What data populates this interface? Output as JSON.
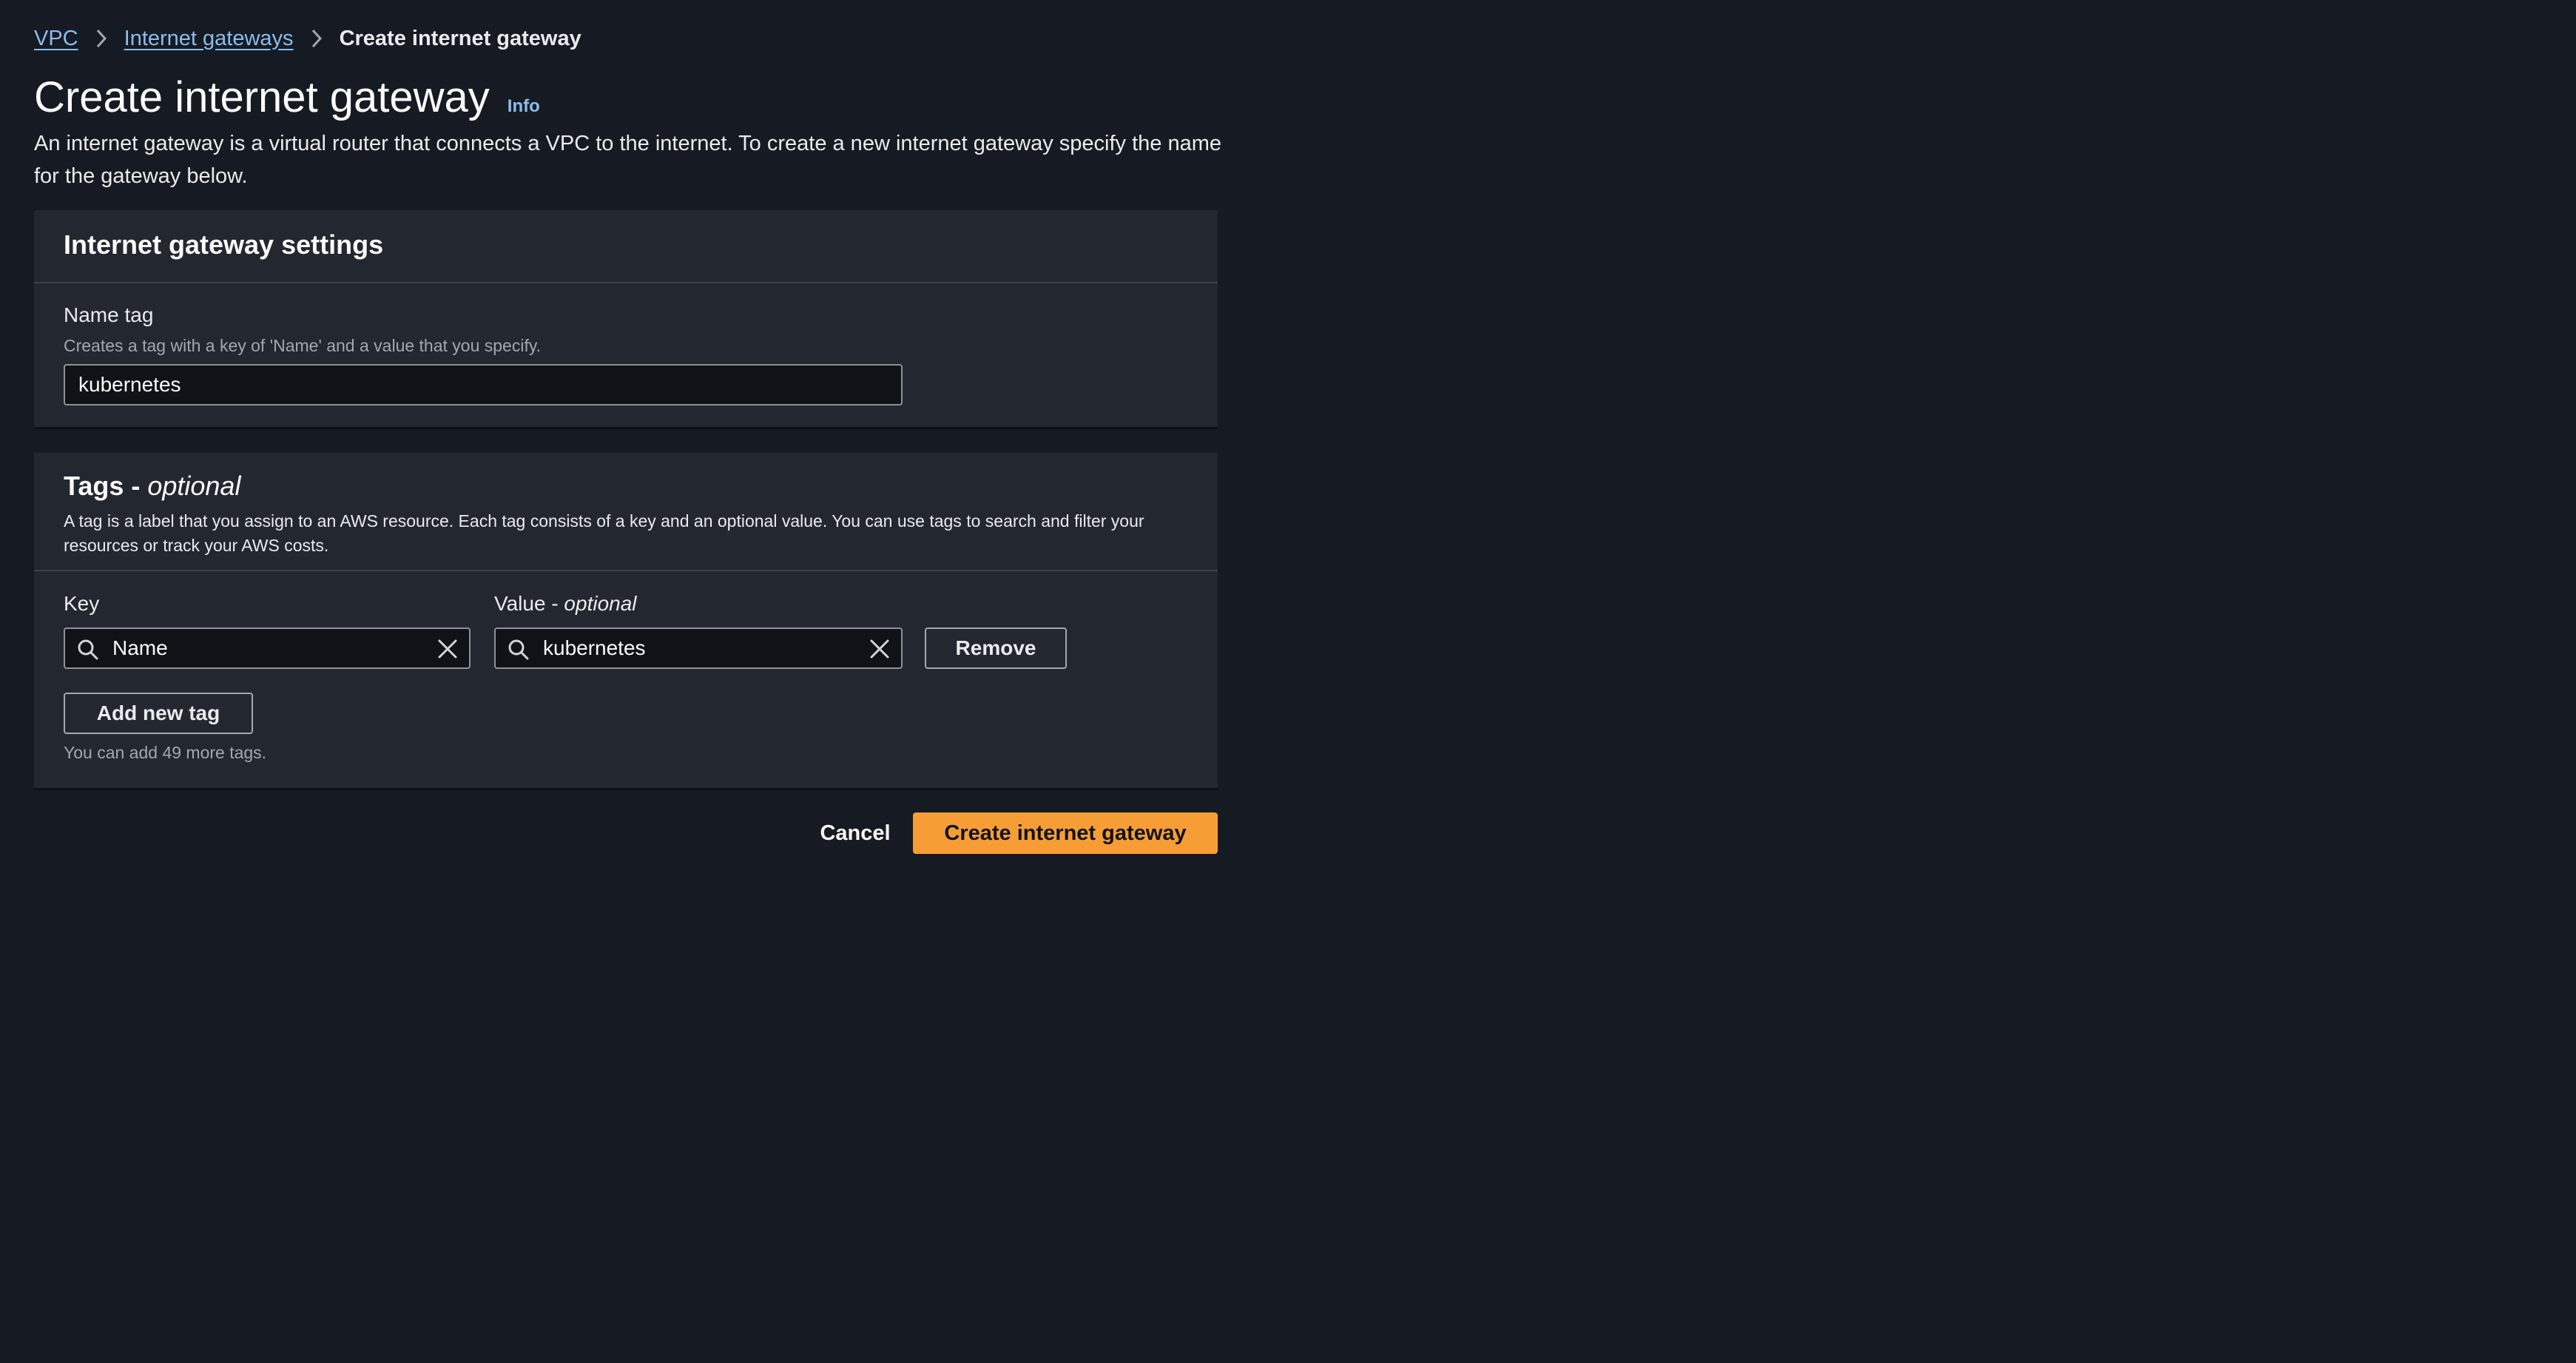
{
  "breadcrumb": {
    "items": [
      {
        "label": "VPC"
      },
      {
        "label": "Internet gateways"
      }
    ],
    "current": "Create internet gateway"
  },
  "header": {
    "title": "Create internet gateway",
    "info_label": "Info",
    "description": "An internet gateway is a virtual router that connects a VPC to the internet. To create a new internet gateway specify the name for the gateway below."
  },
  "settings": {
    "title": "Internet gateway settings",
    "name_tag": {
      "label": "Name tag",
      "description": "Creates a tag with a key of 'Name' and a value that you specify.",
      "value": "kubernetes"
    }
  },
  "tags": {
    "title": "Tags - ",
    "title_optional": "optional",
    "description": "A tag is a label that you assign to an AWS resource. Each tag consists of a key and an optional value. You can use tags to search and filter your resources or track your AWS costs.",
    "key_label": "Key",
    "value_label": "Value - ",
    "value_label_optional": "optional",
    "rows": [
      {
        "key": "Name",
        "value": "kubernetes"
      }
    ],
    "remove_label": "Remove",
    "add_label": "Add new tag",
    "remaining_text": "You can add 49 more tags."
  },
  "actions": {
    "cancel_label": "Cancel",
    "submit_label": "Create internet gateway"
  },
  "colors": {
    "background": "#161a22",
    "panel": "#232730",
    "link": "#89bdee",
    "primary": "#f79d36"
  }
}
